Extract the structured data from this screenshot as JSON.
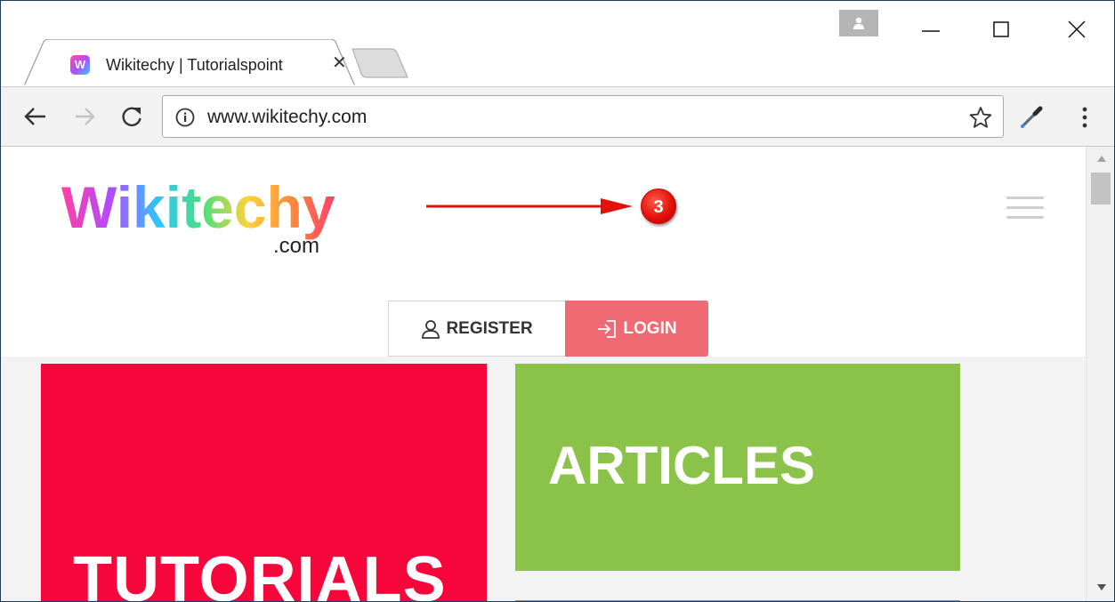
{
  "browser": {
    "tab": {
      "favicon_letter": "W",
      "title": "Wikitechy | Tutorialspoint",
      "close_glyph": "✕"
    },
    "address": {
      "url": "www.wikitechy.com"
    },
    "icons": [
      "back-arrow-icon",
      "forward-arrow-icon",
      "reload-icon",
      "info-icon",
      "star-icon",
      "eyedropper-icon",
      "menu-dots-icon",
      "profile-icon",
      "minimize-icon",
      "maximize-icon",
      "close-icon"
    ]
  },
  "page": {
    "logo": {
      "brand": "Wikitechy",
      "domain": ".com"
    },
    "annotation": {
      "step_number": "3",
      "color": "#e2120b"
    },
    "auth": {
      "register_label": "REGISTER",
      "login_label": "LOGIN"
    },
    "tiles": [
      {
        "label": "TUTORIALS",
        "color": "#f7063b"
      },
      {
        "label": "ARTICLES",
        "color": "#8bc34a"
      },
      {
        "label": "",
        "color": "#d3783b"
      }
    ]
  },
  "colors": {
    "login_button": "#ef6a73",
    "toolbar": "#f2f2f2"
  }
}
